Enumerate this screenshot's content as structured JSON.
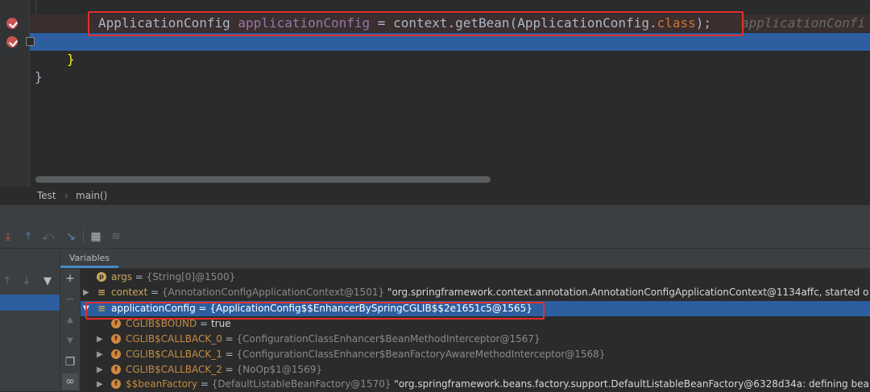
{
  "editor": {
    "line1": {
      "type_name": "ApplicationConfig",
      "var_name": "applicationConfig",
      "rest": " = context.getBean(ApplicationConfig.",
      "class_kw": "class",
      "end": ");",
      "inline_hint": "applicationConfi"
    },
    "line2": {
      "text": "}"
    },
    "line3": {
      "text": "}"
    }
  },
  "breadcrumb": {
    "items": [
      "Test",
      "main()"
    ],
    "separator": "›"
  },
  "debug_toolbar": {
    "icons": [
      "step-into-icon",
      "step-out-icon",
      "drop-frame-icon",
      "run-to-cursor-icon",
      "evaluate-expression-icon",
      "trace-icon"
    ]
  },
  "frames_panel": {
    "icons": [
      "up-arrow-icon",
      "down-arrow-icon",
      "filter-icon"
    ]
  },
  "variables": {
    "tab_label": "Variables",
    "side_icons": [
      "add-watch-icon",
      "minus-icon",
      "up-icon",
      "down-icon",
      "copy-icon",
      "glasses-icon"
    ],
    "rows": [
      {
        "name": "args",
        "eq": " = ",
        "value": "{String[0]@1500}",
        "extra": ""
      },
      {
        "name": "context",
        "eq": " = ",
        "value": "{AnnotationConfigApplicationContext@1501}",
        "extra": " \"org.springframework.context.annotation.AnnotationConfigApplicationContext@1134affc, started o"
      },
      {
        "name": "applicationConfig",
        "eq": " = ",
        "value": "{ApplicationConfig$$EnhancerBySpringCGLIB$$2e1651c5@1565}",
        "extra": ""
      },
      {
        "name": "CGLIB$BOUND",
        "eq": " = ",
        "value": "true",
        "extra": ""
      },
      {
        "name": "CGLIB$CALLBACK_0",
        "eq": " = ",
        "value": "{ConfigurationClassEnhancer$BeanMethodInterceptor@1567}",
        "extra": ""
      },
      {
        "name": "CGLIB$CALLBACK_1",
        "eq": " = ",
        "value": "{ConfigurationClassEnhancer$BeanFactoryAwareMethodInterceptor@1568}",
        "extra": ""
      },
      {
        "name": "CGLIB$CALLBACK_2",
        "eq": " = ",
        "value": "{NoOp$1@1569}",
        "extra": ""
      },
      {
        "name": "$$beanFactory",
        "eq": " = ",
        "value": "{DefaultListableBeanFactory@1570}",
        "extra": " \"org.springframework.beans.factory.support.DefaultListableBeanFactory@6328d34a: defining bea"
      }
    ]
  },
  "colors": {
    "highlight_box": "#e0302d",
    "selection": "#2d5ea0",
    "breakpoint": "#c75450"
  }
}
